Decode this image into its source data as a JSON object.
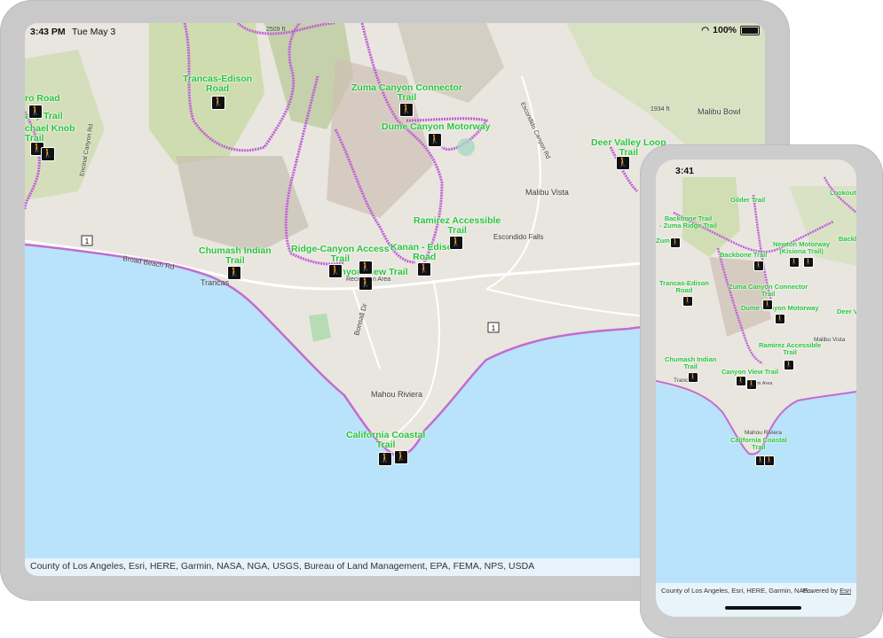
{
  "ipad": {
    "status": {
      "time": "3:43 PM",
      "date": "Tue May 3",
      "battery": "100%"
    },
    "attribution": "County of Los Angeles, Esri, HERE, Garmin, NASA, NGA, USGS, Bureau of Land Management, EPA, FEMA, NPS, USDA",
    "trail_labels": [
      "Trancas-Edison\nRoad",
      "Zuma Canyon Connector\nTrail",
      "Dume Canyon Motorway",
      "Deer Valley Loop\nTrail",
      "Ramirez Accessible\nTrail",
      "Chumash Indian\nTrail",
      "Ridge-Canyon Access\nTrail",
      "Kanan - Edison\nRoad",
      "Canyon View Trail",
      "California Coastal\nTrail",
      "ro Road",
      "any Trail",
      "chael Knob\nTrail"
    ],
    "places": [
      "Malibu Vista",
      "Malibu Bowl",
      "Escondido Falls",
      "Trancas",
      "Mahou Riviera",
      "Broad Beach Rd",
      "Bonsall Dr",
      "Recreation Area",
      "1934 ft",
      "2509 ft",
      "Escondido Canyon Rd",
      "Encinal Canyon Rd"
    ],
    "route_shields": [
      "1",
      "1"
    ]
  },
  "iphone": {
    "status": {
      "time": "3:41"
    },
    "attribution": "County of Los Angeles, Esri, HERE, Garmin, NAS...",
    "powered_by_prefix": "Powered by",
    "powered_by_link": "Esri",
    "trail_labels": [
      "Gilder Trail",
      "Backbone Trail\n- Zuma Ridge Trail",
      "Backbone Trail",
      "Newton Motorway\n(Kisiona Trail)",
      "Trancas-Edison\nRoad",
      "Zuma Canyon Connector\nTrail",
      "Dume Canyon Motorway",
      "Ramirez Accessible\nTrail",
      "Chumash Indian\nTrail",
      "Canyon View Trail",
      "California Coastal\nTrail",
      "Lookout",
      "Backb",
      "Deer V",
      "Zuma"
    ],
    "places": [
      "Malibu Vista",
      "Mahou Riviera",
      "Trancas",
      "Recreation Area"
    ]
  },
  "colors": {
    "water": "#b8e3fa",
    "land": "#e9e6df",
    "vegetation": "#c9d9a9",
    "trail": "#c060d8",
    "trail_label": "#27c43b",
    "device_frame": "#c9c9c9"
  },
  "icons": [
    "hiker-icon",
    "wifi-icon",
    "battery-icon"
  ]
}
